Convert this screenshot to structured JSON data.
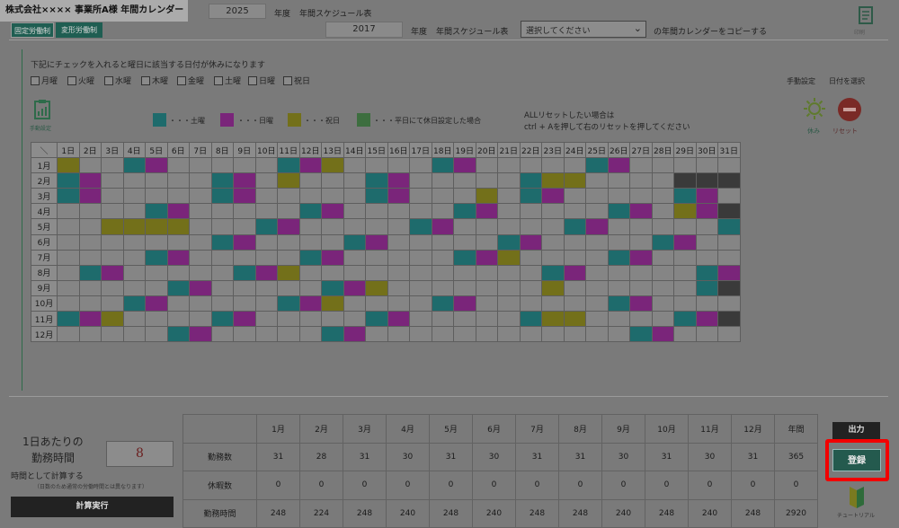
{
  "header": {
    "title": "株式会社×××× 事業所A様 年間カレンダー",
    "year": "2025",
    "year_suffix": "年度",
    "schedule_label": "年間スケジュール表",
    "fixed_tab": "固定労働制",
    "variable_tab": "変形労働制"
  },
  "copy_row": {
    "year": "2017",
    "year_suffix": "年度",
    "schedule_label": "年間スケジュール表",
    "select_value": "選択してください",
    "suffix": "の年間カレンダーをコピーする"
  },
  "top_icon_label": "印刷",
  "weekday_section": {
    "instruction": "下記にチェックを入れると曜日に該当する日付が休みになります",
    "days": [
      "月曜",
      "火曜",
      "水曜",
      "木曜",
      "金曜",
      "土曜",
      "日曜",
      "祝日"
    ],
    "manual_label": "手動設定",
    "select_date_label": "日付を選択"
  },
  "legend": {
    "saturday": "・・・土曜",
    "sunday": "・・・日曜",
    "holiday": "・・・祝日",
    "weekday_off": "・・・平日にて休日設定した場合",
    "reset_note_1": "ALLリセットしたい場合は",
    "reset_note_2": "ctrl + Aを押して右のリセットを押してください",
    "rest_label": "休み",
    "reset_label": "リセット",
    "left_icon_label": "手動設定"
  },
  "colors": {
    "saturday": "#1e6b6c",
    "sunday": "#7a257a",
    "holiday": "#73701a",
    "weekday_off": "#3d6e3f",
    "highlight": "#f20000"
  },
  "calendar": {
    "corner": "＼",
    "day_headers": [
      "1日",
      "2日",
      "3日",
      "4日",
      "5日",
      "6日",
      "7日",
      "8日",
      "9日",
      "10日",
      "11日",
      "12日",
      "13日",
      "14日",
      "15日",
      "16日",
      "17日",
      "18日",
      "19日",
      "20日",
      "21日",
      "22日",
      "23日",
      "24日",
      "25日",
      "26日",
      "27日",
      "28日",
      "29日",
      "30日",
      "31日"
    ],
    "months": [
      "1月",
      "2月",
      "3月",
      "4月",
      "5月",
      "6月",
      "7月",
      "8月",
      "9月",
      "10月",
      "11月",
      "12月"
    ],
    "rows": [
      "hpppsuppppsuhppppsupppppsuppppp",
      "susppsuppphppsupppsuhhppsuppnnn",
      "suppsuppppssuppphppsuppsuppsupp",
      "pppsuppppphuppppssuppsuppsupppp",
      "psuhhhppsupppsuppsuppppsuppsupss",
      "pppppsupsuppppsuppppsuppsuppsups",
      "pppsuppppppsuppppsuhppsuppsupppp",
      "psuppppsusuhppppppppsuppppppsupp",
      "pppppsuppppppsuhpppppphpppppssnp",
      "ppssuppppphuppppppsupppppsupppp",
      "suhppsuppppsuppppsuhhppsppppsuppppppsuhhppppn",
      "pppppsuppppppsupppppppsuppppsupp"
    ],
    "cells": [
      [
        "h",
        "p",
        "p",
        "s",
        "u",
        "p",
        "p",
        "p",
        "p",
        "p",
        "s",
        "u",
        "h",
        "p",
        "p",
        "p",
        "p",
        "s",
        "u",
        "p",
        "p",
        "p",
        "p",
        "p",
        "s",
        "u",
        "p",
        "p",
        "p",
        "p",
        "p"
      ],
      [
        "s",
        "u",
        "p",
        "p",
        "p",
        "p",
        "p",
        "s",
        "u",
        "p",
        "h",
        "p",
        "p",
        "p",
        "s",
        "u",
        "p",
        "p",
        "p",
        "p",
        "p",
        "s",
        "h",
        "h",
        "p",
        "p",
        "p",
        "p",
        "n",
        "n",
        "n"
      ],
      [
        "s",
        "u",
        "p",
        "p",
        "p",
        "p",
        "p",
        "s",
        "u",
        "p",
        "p",
        "p",
        "p",
        "p",
        "s",
        "u",
        "p",
        "p",
        "p",
        "h",
        "p",
        "s",
        "u",
        "p",
        "p",
        "p",
        "p",
        "p",
        "s",
        "u",
        "p"
      ],
      [
        "p",
        "p",
        "p",
        "p",
        "s",
        "u",
        "p",
        "p",
        "p",
        "p",
        "p",
        "s",
        "u",
        "p",
        "p",
        "p",
        "p",
        "p",
        "s",
        "u",
        "p",
        "p",
        "p",
        "p",
        "p",
        "s",
        "u",
        "p",
        "h",
        "u",
        "n"
      ],
      [
        "p",
        "p",
        "h",
        "h",
        "h",
        "h",
        "p",
        "p",
        "p",
        "s",
        "u",
        "p",
        "p",
        "p",
        "p",
        "p",
        "s",
        "u",
        "p",
        "p",
        "p",
        "p",
        "p",
        "s",
        "u",
        "p",
        "p",
        "p",
        "p",
        "p",
        "s"
      ],
      [
        "p",
        "p",
        "p",
        "p",
        "p",
        "p",
        "p",
        "s",
        "u",
        "p",
        "p",
        "p",
        "p",
        "s",
        "u",
        "p",
        "p",
        "p",
        "p",
        "p",
        "s",
        "u",
        "p",
        "p",
        "p",
        "p",
        "p",
        "s",
        "u",
        "p",
        "p"
      ],
      [
        "p",
        "p",
        "p",
        "p",
        "s",
        "u",
        "p",
        "p",
        "p",
        "p",
        "p",
        "s",
        "u",
        "p",
        "p",
        "p",
        "p",
        "p",
        "s",
        "u",
        "h",
        "p",
        "p",
        "p",
        "p",
        "s",
        "u",
        "p",
        "p",
        "p",
        "p"
      ],
      [
        "p",
        "s",
        "u",
        "p",
        "p",
        "p",
        "p",
        "p",
        "s",
        "u",
        "h",
        "p",
        "p",
        "p",
        "p",
        "p",
        "p",
        "p",
        "p",
        "p",
        "p",
        "p",
        "s",
        "u",
        "p",
        "p",
        "p",
        "p",
        "p",
        "s",
        "u"
      ],
      [
        "p",
        "p",
        "p",
        "p",
        "p",
        "s",
        "u",
        "p",
        "p",
        "p",
        "p",
        "p",
        "s",
        "u",
        "h",
        "p",
        "p",
        "p",
        "p",
        "p",
        "p",
        "p",
        "h",
        "p",
        "p",
        "p",
        "p",
        "p",
        "p",
        "s",
        "n"
      ],
      [
        "p",
        "p",
        "p",
        "s",
        "u",
        "p",
        "p",
        "p",
        "p",
        "p",
        "s",
        "u",
        "h",
        "p",
        "p",
        "p",
        "p",
        "s",
        "u",
        "p",
        "p",
        "p",
        "p",
        "p",
        "p",
        "s",
        "u",
        "p",
        "p",
        "p",
        "p"
      ],
      [
        "s",
        "u",
        "h",
        "p",
        "p",
        "p",
        "p",
        "s",
        "u",
        "p",
        "p",
        "p",
        "p",
        "p",
        "s",
        "u",
        "p",
        "p",
        "p",
        "p",
        "p",
        "s",
        "h",
        "h",
        "p",
        "p",
        "p",
        "p",
        "s",
        "u",
        "n"
      ],
      [
        "p",
        "p",
        "p",
        "p",
        "p",
        "s",
        "u",
        "p",
        "p",
        "p",
        "p",
        "p",
        "s",
        "u",
        "p",
        "p",
        "p",
        "p",
        "p",
        "p",
        "p",
        "p",
        "p",
        "p",
        "p",
        "p",
        "s",
        "u",
        "p",
        "p",
        "p"
      ]
    ]
  },
  "hours_panel": {
    "label_1": "1日あたりの",
    "label_2": "勤務時間",
    "value": "8",
    "note_1": "時間として計算する",
    "note_2": "（日数のため通常の労働時間とは異なります）",
    "calc_button": "計算実行"
  },
  "stats": {
    "headers": [
      "",
      "1月",
      "2月",
      "3月",
      "4月",
      "5月",
      "6月",
      "7月",
      "8月",
      "9月",
      "10月",
      "11月",
      "12月",
      "年間"
    ],
    "rows": [
      {
        "label": "勤務数",
        "values": [
          "31",
          "28",
          "31",
          "30",
          "31",
          "30",
          "31",
          "31",
          "30",
          "31",
          "30",
          "31",
          "365"
        ]
      },
      {
        "label": "休暇数",
        "values": [
          "0",
          "0",
          "0",
          "0",
          "0",
          "0",
          "0",
          "0",
          "0",
          "0",
          "0",
          "0",
          "0"
        ]
      },
      {
        "label": "勤務時間",
        "values": [
          "248",
          "224",
          "248",
          "240",
          "248",
          "240",
          "248",
          "248",
          "240",
          "248",
          "240",
          "248",
          "2920"
        ]
      }
    ]
  },
  "actions": {
    "output": "出力",
    "register": "登録",
    "tutorial": "チュートリアル"
  }
}
